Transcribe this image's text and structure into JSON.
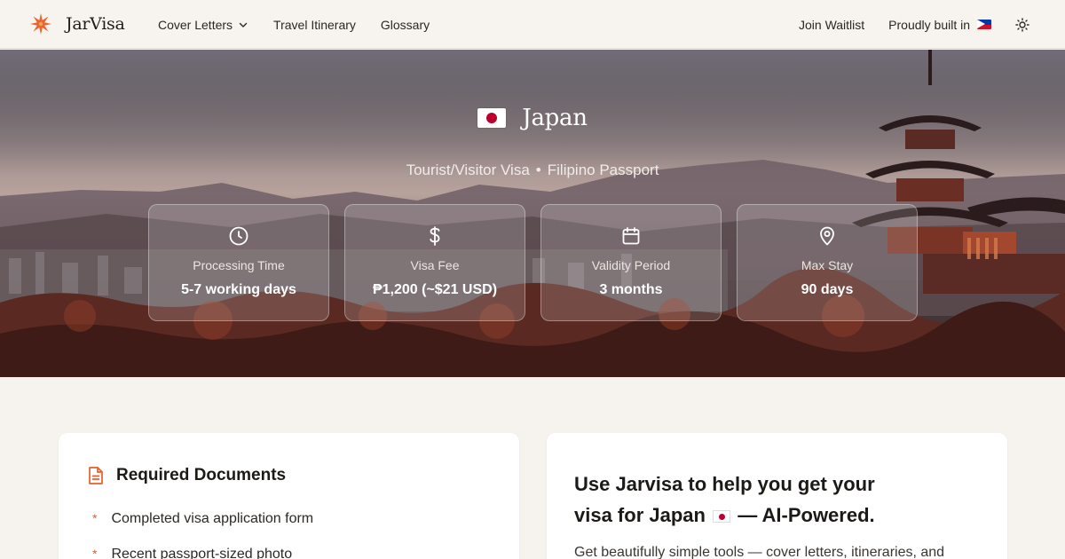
{
  "nav": {
    "brand": "JarVisa",
    "links": [
      "Cover Letters",
      "Travel Itinerary",
      "Glossary"
    ],
    "join_waitlist": "Join Waitlist",
    "built_in": "Proudly built in",
    "icons": {
      "logo": "asterisk-flower-icon",
      "dropdown": "chevron-down-icon",
      "flag": "philippines-flag-icon",
      "theme": "sun-icon"
    }
  },
  "hero": {
    "country": "Japan",
    "visa_type": "Tourist/Visitor Visa",
    "separator": "•",
    "passport": "Filipino Passport",
    "stats": [
      {
        "icon": "clock-icon",
        "label": "Processing Time",
        "value": "5-7 working days"
      },
      {
        "icon": "dollar-icon",
        "label": "Visa Fee",
        "value": "₱1,200 (~$21 USD)"
      },
      {
        "icon": "calendar-icon",
        "label": "Validity Period",
        "value": "3 months"
      },
      {
        "icon": "map-pin-icon",
        "label": "Max Stay",
        "value": "90 days"
      }
    ]
  },
  "docs": {
    "title": "Required Documents",
    "items": [
      "Completed visa application form",
      "Recent passport-sized photo"
    ],
    "bullet": "*"
  },
  "promo": {
    "line1": "Use Jarvisa to help you get your",
    "line2_start": "visa for Japan",
    "line2_end": "— AI-Powered.",
    "body": "Get beautifully simple tools — cover letters, itineraries, and"
  },
  "colors": {
    "accent": "#e2602b",
    "page_bg": "#f6f3ee",
    "card_bg": "#ffffff"
  }
}
